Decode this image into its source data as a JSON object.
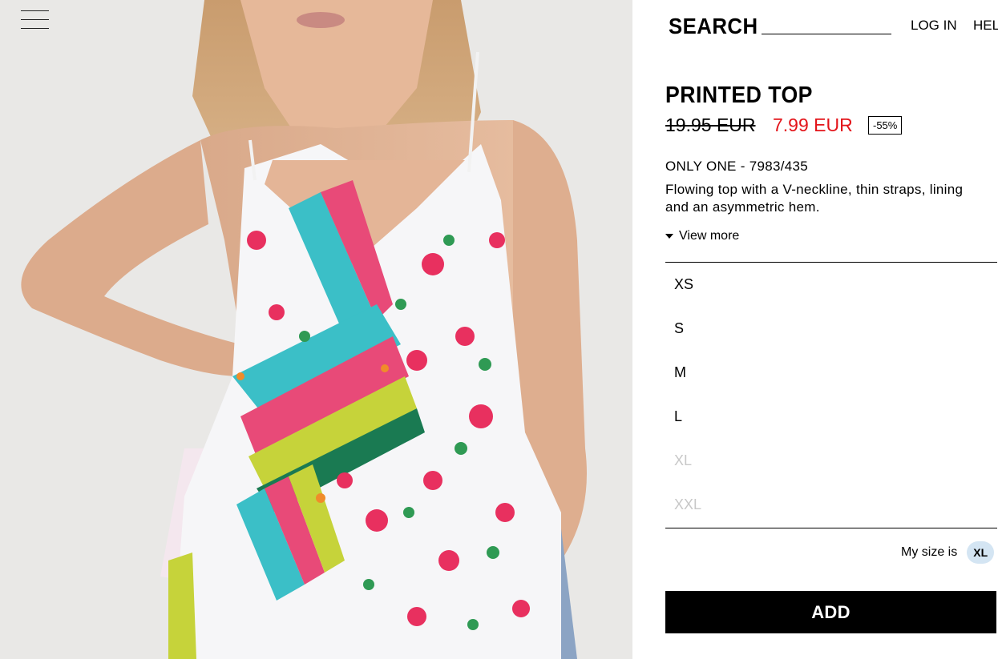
{
  "header": {
    "search_label": "SEARCH",
    "search_placeholder": "",
    "login_label": "LOG IN",
    "help_label": "HEL"
  },
  "product": {
    "title": "PRINTED TOP",
    "old_price": "19.95 EUR",
    "new_price": "7.99 EUR",
    "discount": "-55%",
    "reference": "ONLY ONE - 7983/435",
    "description": "Flowing top with a V-neckline, thin straps, lining and an asymmetric hem.",
    "view_more_label": "View more"
  },
  "sizes": [
    {
      "label": "XS",
      "available": true
    },
    {
      "label": "S",
      "available": true
    },
    {
      "label": "M",
      "available": true
    },
    {
      "label": "L",
      "available": true
    },
    {
      "label": "XL",
      "available": false
    },
    {
      "label": "XXL",
      "available": false
    }
  ],
  "my_size": {
    "label": "My size is",
    "value": "XL"
  },
  "add_button_label": "ADD",
  "colors": {
    "sale_price": "#e3141a",
    "size_unavailable": "#c8c8c8",
    "my_size_badge": "#d4e5f3",
    "photo_background": "#e9e8e6"
  },
  "icons": {
    "menu": "hamburger-menu-icon",
    "view_more": "caret-down-icon"
  }
}
